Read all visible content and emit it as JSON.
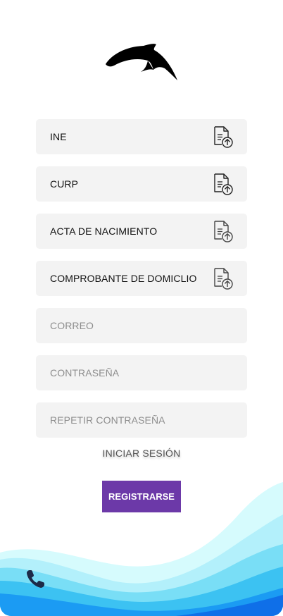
{
  "documents": [
    {
      "label": "INE",
      "icon": "file-upload-icon"
    },
    {
      "label": "CURP",
      "icon": "file-upload-icon"
    },
    {
      "label": "ACTA DE NACIMIENTO",
      "icon": "file-upload-icon"
    },
    {
      "label": "COMPROBANTE DE DOMICLIO",
      "icon": "file-upload-icon"
    }
  ],
  "inputs": {
    "email_placeholder": "CORREO",
    "password_placeholder": "CONTRASEÑA",
    "repeat_password_placeholder": "REPETIR CONTRASEÑA"
  },
  "login_link": "INICIAR SESIÓN",
  "register_button": "REGISTRARSE",
  "icons": {
    "logo": "dolphin-logo",
    "contact": "phone-icon"
  },
  "colors": {
    "accent": "#6c39a8",
    "field_bg": "#f3f3f3",
    "wave_light": "#c8f6fc",
    "wave_mid": "#58d4f3",
    "wave_dark": "#1a86f0"
  }
}
